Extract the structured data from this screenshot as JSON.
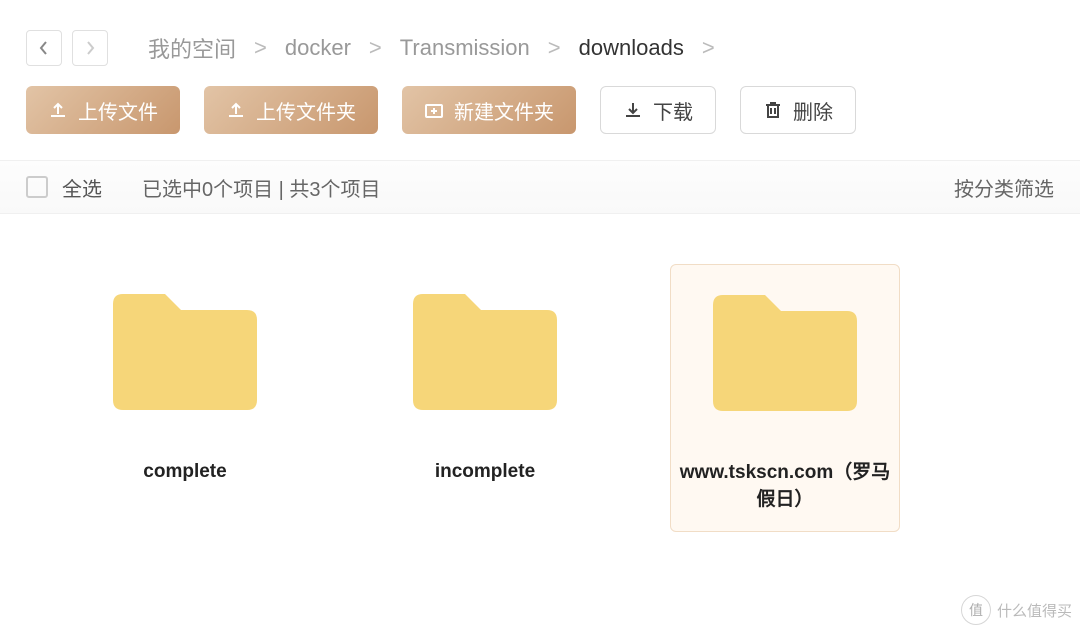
{
  "nav": {
    "back_label": "后退",
    "forward_label": "前进"
  },
  "breadcrumb": {
    "items": [
      {
        "label": "我的空间",
        "current": false
      },
      {
        "label": "docker",
        "current": false
      },
      {
        "label": "Transmission",
        "current": false
      },
      {
        "label": "downloads",
        "current": true
      }
    ],
    "separator": ">"
  },
  "toolbar": {
    "upload_file": "上传文件",
    "upload_folder": "上传文件夹",
    "new_folder": "新建文件夹",
    "download": "下载",
    "delete": "删除"
  },
  "selection": {
    "select_all": "全选",
    "info": "已选中0个项目 | 共3个项目",
    "filter": "按分类筛选"
  },
  "files": [
    {
      "name": "complete",
      "type": "folder",
      "selected": false
    },
    {
      "name": "incomplete",
      "type": "folder",
      "selected": false
    },
    {
      "name": "www.tskscn.com（罗马假日）",
      "type": "folder",
      "selected": true
    }
  ],
  "watermark": {
    "badge": "值",
    "text": "什么值得买"
  },
  "colors": {
    "accent_start": "#e2c4a6",
    "accent_end": "#c8976e",
    "folder": "#f6d679"
  }
}
